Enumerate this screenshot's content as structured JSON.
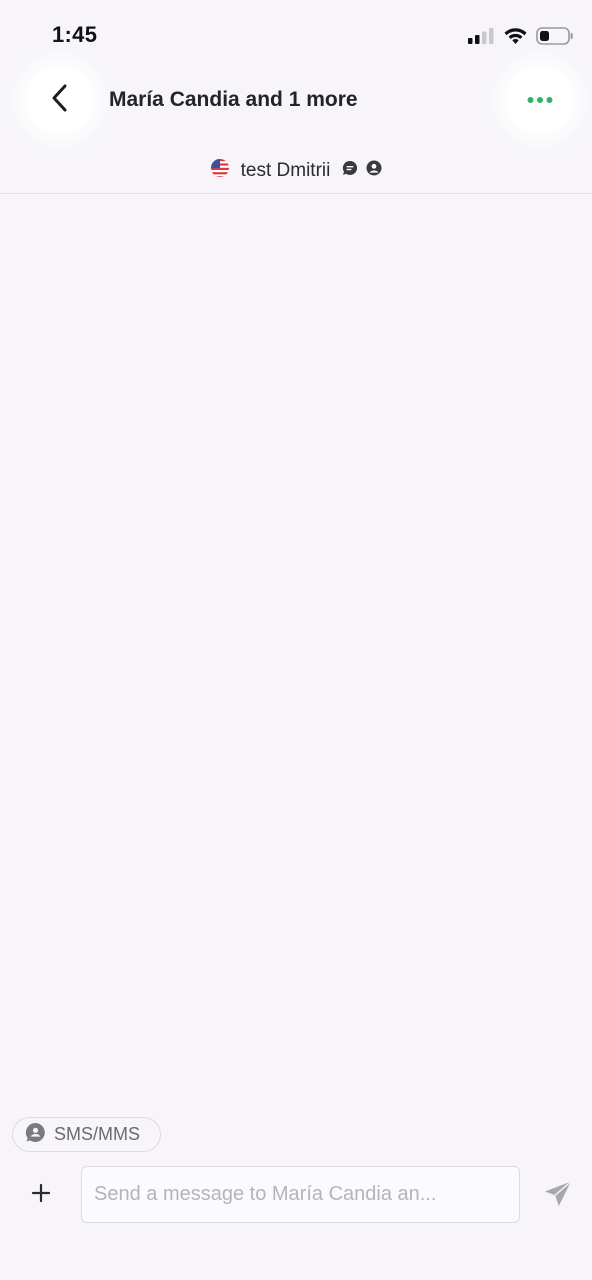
{
  "status_bar": {
    "time": "1:45",
    "icons": [
      "cellular-signal-icon",
      "wifi-icon",
      "battery-icon"
    ]
  },
  "header": {
    "title": "María Candia and 1 more",
    "subtitle": "test Dmitrii",
    "back_icon": "chevron-left-icon",
    "more_icon": "more-dots-icon",
    "flag_icon": "us-flag-icon",
    "subtitle_icons": [
      "chat-bubble-icon",
      "contact-avatar-icon"
    ],
    "accent_color": "#2fb36b"
  },
  "composer": {
    "channel_label": "SMS/MMS",
    "channel_icon": "sms-bubble-icon",
    "input_placeholder": "Send a message to María Candia an...",
    "input_value": "",
    "add_icon": "plus-icon",
    "send_icon": "send-icon"
  }
}
